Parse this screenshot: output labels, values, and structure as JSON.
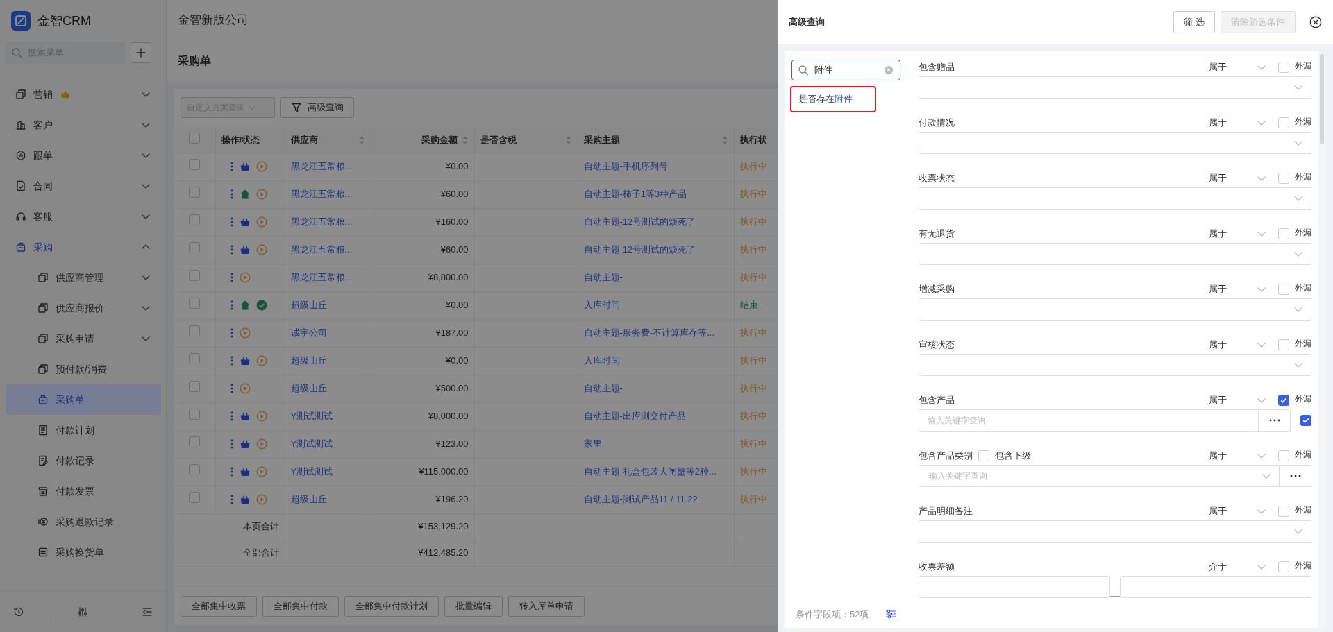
{
  "sidebar": {
    "brand": "金智CRM",
    "search": {
      "placeholder": "搜索菜单"
    },
    "items": [
      {
        "label": "营销",
        "kind": "copy",
        "crown": true,
        "expandable": true,
        "expanded": false,
        "selected": false
      },
      {
        "label": "客户",
        "kind": "building",
        "crown": false,
        "expandable": true,
        "expanded": false,
        "selected": false
      },
      {
        "label": "跟单",
        "kind": "hex",
        "crown": false,
        "expandable": true,
        "expanded": false,
        "selected": false
      },
      {
        "label": "合同",
        "kind": "file",
        "crown": false,
        "expandable": true,
        "expanded": false,
        "selected": false
      },
      {
        "label": "客服",
        "kind": "headset",
        "crown": false,
        "expandable": true,
        "expanded": false,
        "selected": false
      },
      {
        "label": "采购",
        "kind": "bag",
        "crown": false,
        "expandable": true,
        "expanded": true,
        "selected": false,
        "children": [
          {
            "label": "供应商管理",
            "kind": "copy",
            "expandable": true,
            "expanded": false,
            "selected": false
          },
          {
            "label": "供应商报价",
            "kind": "copy",
            "expandable": true,
            "expanded": false,
            "selected": false
          },
          {
            "label": "采购申请",
            "kind": "copy",
            "expandable": true,
            "expanded": false,
            "selected": false
          },
          {
            "label": "预付款/消费",
            "kind": "copy",
            "expandable": false,
            "selected": false
          },
          {
            "label": "采购单",
            "kind": "bag",
            "expandable": false,
            "selected": true
          },
          {
            "label": "付款计划",
            "kind": "listdoc",
            "expandable": false,
            "selected": false
          },
          {
            "label": "付款记录",
            "kind": "notes",
            "expandable": false,
            "selected": false
          },
          {
            "label": "付款发票",
            "kind": "invoice",
            "expandable": false,
            "selected": false
          },
          {
            "label": "采购退款记录",
            "kind": "coin",
            "expandable": false,
            "selected": false
          },
          {
            "label": "采购换货单",
            "kind": "exchange",
            "expandable": false,
            "selected": false
          }
        ]
      }
    ]
  },
  "header": {
    "company": "金智新版公司"
  },
  "page": {
    "title": "采购单"
  },
  "toolbar": {
    "scheme": {
      "placeholder": "自定义方案查询",
      "disabled": true
    },
    "advanced_button": "高级查询"
  },
  "table": {
    "header_checked": false,
    "columns": [
      {
        "label": "操作/状态",
        "sortable": false
      },
      {
        "label": "供应商",
        "sortable": true
      },
      {
        "label": "采购金额",
        "sortable": true
      },
      {
        "label": "是否含税",
        "sortable": true
      },
      {
        "label": "采购主题",
        "sortable": true
      },
      {
        "label": "执行状",
        "sortable": false
      }
    ],
    "rows": [
      {
        "checked": false,
        "status_icons": [
          {
            "kind": "basket"
          },
          {
            "kind": "play"
          }
        ],
        "supplier": "黑龙江五常粮...",
        "amount": "¥0.00",
        "subject": "自动主题-手机序列号",
        "status": {
          "text": "执行中",
          "color": "#7f5921"
        }
      },
      {
        "checked": false,
        "status_icons": [
          {
            "kind": "house"
          },
          {
            "kind": "play"
          }
        ],
        "supplier": "黑龙江五常粮...",
        "amount": "¥60.00",
        "subject": "自动主题-柿子1等3种产品",
        "status": {
          "text": "执行中",
          "color": "#7f5921"
        }
      },
      {
        "checked": false,
        "status_icons": [
          {
            "kind": "basket"
          },
          {
            "kind": "play"
          }
        ],
        "supplier": "黑龙江五常粮...",
        "amount": "¥160.00",
        "subject": "自动主题-12号测试的烦死了",
        "status": {
          "text": "执行中",
          "color": "#7f5921"
        }
      },
      {
        "checked": false,
        "status_icons": [
          {
            "kind": "basket"
          },
          {
            "kind": "play"
          }
        ],
        "supplier": "黑龙江五常粮...",
        "amount": "¥60.00",
        "subject": "自动主题-12号测试的烦死了",
        "status": {
          "text": "执行中",
          "color": "#7f5921"
        }
      },
      {
        "checked": false,
        "status_icons": [
          {
            "kind": "play"
          }
        ],
        "supplier": "黑龙江五常粮...",
        "amount": "¥8,800.00",
        "subject": "自动主题-",
        "status": {
          "text": "执行中",
          "color": "#7f5921"
        }
      },
      {
        "checked": false,
        "status_icons": [
          {
            "kind": "house"
          },
          {
            "kind": "check"
          }
        ],
        "supplier": "超级山丘",
        "amount": "¥0.00",
        "subject": "入库时间",
        "status": {
          "text": "结束",
          "color": "#17563b"
        }
      },
      {
        "checked": false,
        "status_icons": [
          {
            "kind": "play"
          }
        ],
        "supplier": "诚宇公司",
        "amount": "¥187.00",
        "subject": "自动主题-服务费-不计算库存等...",
        "status": {
          "text": "执行中",
          "color": "#7f5921"
        }
      },
      {
        "checked": false,
        "status_icons": [
          {
            "kind": "basket"
          },
          {
            "kind": "play"
          }
        ],
        "supplier": "超级山丘",
        "amount": "¥0.00",
        "subject": "入库时间",
        "status": {
          "text": "执行中",
          "color": "#7f5921"
        }
      },
      {
        "checked": false,
        "status_icons": [
          {
            "kind": "play"
          }
        ],
        "supplier": "超级山丘",
        "amount": "¥500.00",
        "subject": "自动主题-",
        "status": {
          "text": "执行中",
          "color": "#7f5921"
        }
      },
      {
        "checked": false,
        "status_icons": [
          {
            "kind": "basket"
          },
          {
            "kind": "play"
          }
        ],
        "supplier": "Y测试测试",
        "amount": "¥8,000.00",
        "subject": "自动主题-出库测交付产品",
        "status": {
          "text": "执行中",
          "color": "#7f5921"
        }
      },
      {
        "checked": false,
        "status_icons": [
          {
            "kind": "basket"
          },
          {
            "kind": "play"
          }
        ],
        "supplier": "Y测试测试",
        "amount": "¥123.00",
        "subject": "家里",
        "status": {
          "text": "执行中",
          "color": "#7f5921"
        }
      },
      {
        "checked": false,
        "status_icons": [
          {
            "kind": "basket"
          },
          {
            "kind": "play"
          }
        ],
        "supplier": "Y测试测试",
        "amount": "¥115,000.00",
        "subject": "自动主题-礼盒包装大闸蟹等2种...",
        "status": {
          "text": "执行中",
          "color": "#7f5921"
        }
      },
      {
        "checked": false,
        "status_icons": [
          {
            "kind": "basket"
          },
          {
            "kind": "play"
          }
        ],
        "supplier": "超级山丘",
        "amount": "¥196.20",
        "subject": "自动主题-测试产品11 / 11.22",
        "status": {
          "text": "执行中",
          "color": "#7f5921"
        }
      }
    ],
    "totals": [
      {
        "label": "本页合计",
        "amount": "¥153,129.20"
      },
      {
        "label": "全部合计",
        "amount": "¥412,485.20"
      }
    ]
  },
  "buttons": [
    "全部集中收票",
    "全部集中付款",
    "全部集中付款计划",
    "批量编辑",
    "转入库单申请"
  ],
  "drawer": {
    "title": "高级查询",
    "filter_button": "筛 选",
    "clear_button": {
      "label": "清除筛选条件",
      "disabled": true
    },
    "search": {
      "value": "附件"
    },
    "results": [
      {
        "text": "是否存在",
        "match": "附件",
        "outlined": true
      }
    ],
    "field_count": "条件字段项：52项",
    "fields": [
      {
        "label": "包含赠品",
        "operator": "属于",
        "exclude_label": "外漏",
        "exclude": false,
        "kind": "select"
      },
      {
        "label": "付款情况",
        "operator": "属于",
        "exclude_label": "外漏",
        "exclude": false,
        "kind": "select"
      },
      {
        "label": "收票状态",
        "operator": "属于",
        "exclude_label": "外漏",
        "exclude": false,
        "kind": "select"
      },
      {
        "label": "有无退货",
        "operator": "属于",
        "exclude_label": "外漏",
        "exclude": false,
        "kind": "select"
      },
      {
        "label": "增减采购",
        "operator": "属于",
        "exclude_label": "外漏",
        "exclude": false,
        "kind": "select"
      },
      {
        "label": "审核状态",
        "operator": "属于",
        "exclude_label": "外漏",
        "exclude": false,
        "kind": "select"
      },
      {
        "label": "包含产品",
        "operator": "属于",
        "exclude_label": "外漏",
        "exclude": true,
        "kind": "searchmore",
        "placeholder": "输入关键字查询",
        "extra_checked": true
      },
      {
        "label": "包含产品类别",
        "sub_label": "包含下级",
        "sub_checked": false,
        "operator": "属于",
        "exclude_label": "外漏",
        "exclude": false,
        "kind": "selectmore",
        "placeholder": "输入关键字查询"
      },
      {
        "label": "产品明细备注",
        "operator": "属于",
        "exclude_label": "外漏",
        "exclude": false,
        "kind": "select"
      },
      {
        "label": "收票差额",
        "operator": "介于",
        "exclude_label": "外漏",
        "exclude": false,
        "kind": "range"
      }
    ]
  }
}
